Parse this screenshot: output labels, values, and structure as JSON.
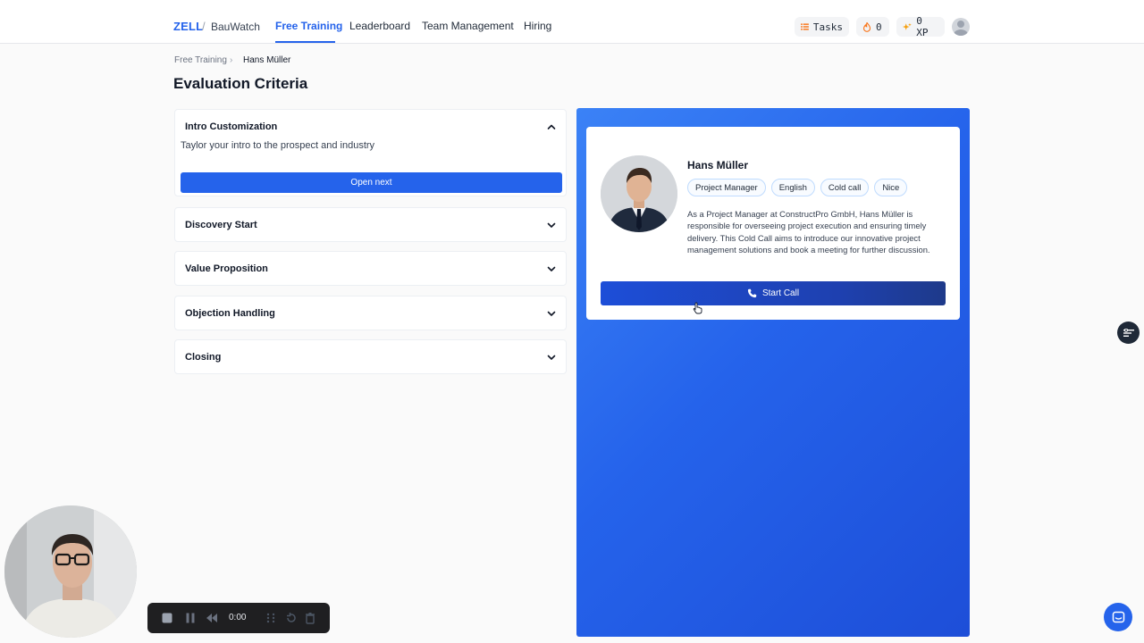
{
  "header": {
    "brand": "ZELL",
    "separator": "/",
    "workspace": "BauWatch",
    "nav": [
      {
        "label": "Free Training",
        "active": true
      },
      {
        "label": "Leaderboard",
        "active": false
      },
      {
        "label": "Team Management",
        "active": false
      },
      {
        "label": "Hiring",
        "active": false
      }
    ],
    "tasks_label": "Tasks",
    "streak_count": "0",
    "xp_label": "0 XP"
  },
  "breadcrumb": {
    "parent": "Free Training",
    "separator": "›",
    "current": "Hans Müller"
  },
  "page_title": "Evaluation Criteria",
  "criteria": [
    {
      "title": "Intro Customization",
      "expanded": true,
      "description": "Taylor your intro to the prospect and industry",
      "button_label": "Open next"
    },
    {
      "title": "Discovery Start",
      "expanded": false
    },
    {
      "title": "Value Proposition",
      "expanded": false
    },
    {
      "title": "Objection Handling",
      "expanded": false
    },
    {
      "title": "Closing",
      "expanded": false
    }
  ],
  "prospect": {
    "name": "Hans Müller",
    "tags": [
      "Project Manager",
      "English",
      "Cold call",
      "Nice"
    ],
    "bio": "As a Project Manager at ConstructPro GmbH, Hans Müller is responsible for overseeing project execution and ensuring timely delivery. This Cold Call aims to introduce our innovative project management solutions and book a meeting for further discussion.",
    "call_button": "Start Call"
  },
  "recorder": {
    "time": "0:00"
  },
  "colors": {
    "accent": "#2563eb",
    "panel_dark": "#1d4ed8",
    "text": "#111827"
  }
}
